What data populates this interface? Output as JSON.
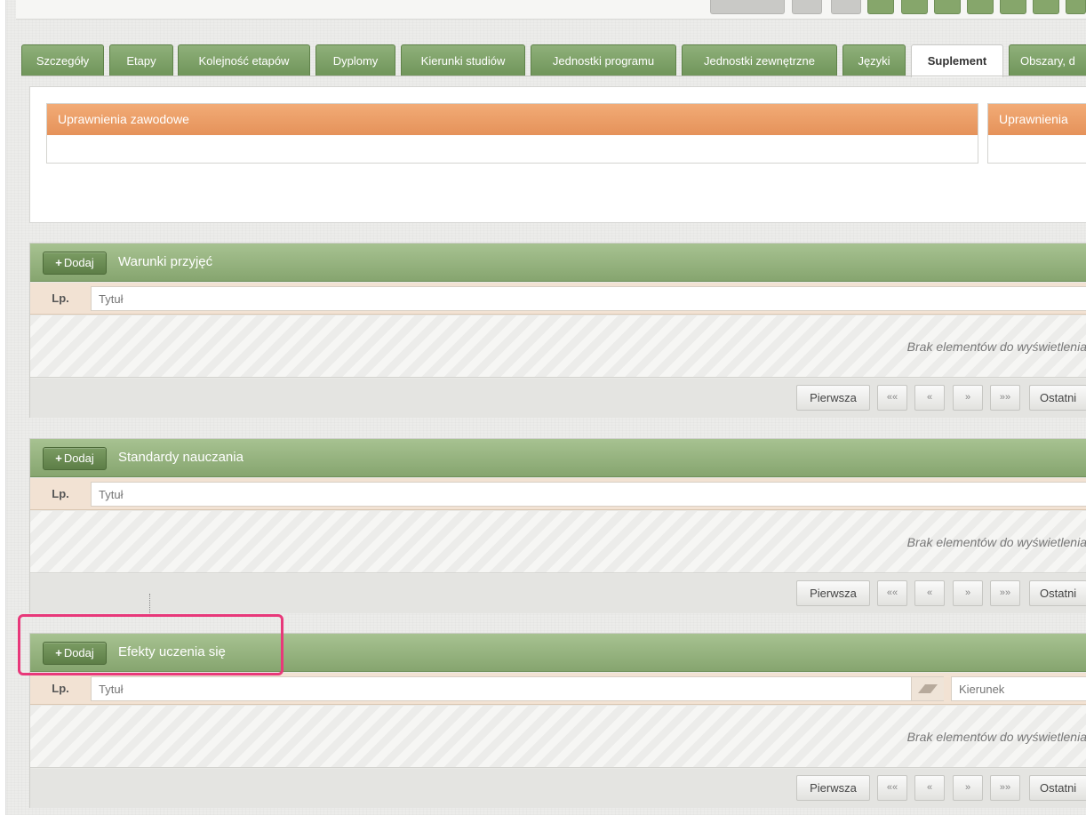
{
  "tabs": [
    {
      "label": "Szczegóły",
      "active": false
    },
    {
      "label": "Etapy",
      "active": false
    },
    {
      "label": "Kolejność etapów",
      "active": false
    },
    {
      "label": "Dyplomy",
      "active": false
    },
    {
      "label": "Kierunki studiów",
      "active": false
    },
    {
      "label": "Jednostki programu",
      "active": false
    },
    {
      "label": "Jednostki zewnętrzne",
      "active": false
    },
    {
      "label": "Języki",
      "active": false
    },
    {
      "label": "Suplement",
      "active": true
    },
    {
      "label": "Obszary, d",
      "active": false
    }
  ],
  "supplement": {
    "box1_title": "Uprawnienia zawodowe",
    "box2_title": "Uprawnienia"
  },
  "sections": [
    {
      "add_label": "Dodaj",
      "title": "Warunki przyjęć",
      "lp_label": "Lp.",
      "filter_placeholder": "Tytuł",
      "empty_message": "Brak elementów do wyświetlenia",
      "pager": [
        "Pierwsza",
        "««",
        "«",
        "»",
        "»»",
        "Ostatni"
      ]
    },
    {
      "add_label": "Dodaj",
      "title": "Standardy nauczania",
      "lp_label": "Lp.",
      "filter_placeholder": "Tytuł",
      "empty_message": "Brak elementów do wyświetlenia",
      "pager": [
        "Pierwsza",
        "««",
        "«",
        "»",
        "»»",
        "Ostatni"
      ]
    },
    {
      "add_label": "Dodaj",
      "title": "Efekty uczenia się",
      "lp_label": "Lp.",
      "filter_placeholder": "Tytuł",
      "filter2_placeholder": "Kierunek",
      "empty_message": "Brak elementów do wyświetlenia",
      "pager": [
        "Pierwsza",
        "««",
        "«",
        "»",
        "»»",
        "Ostatni"
      ]
    }
  ],
  "icons": {
    "add": "plus-icon",
    "sort": "sort-triangle-icon"
  },
  "colors": {
    "tab_green": "#7fa168",
    "header_orange": "#ea9a62",
    "section_green": "#97b580",
    "highlight": "#e8387a"
  }
}
